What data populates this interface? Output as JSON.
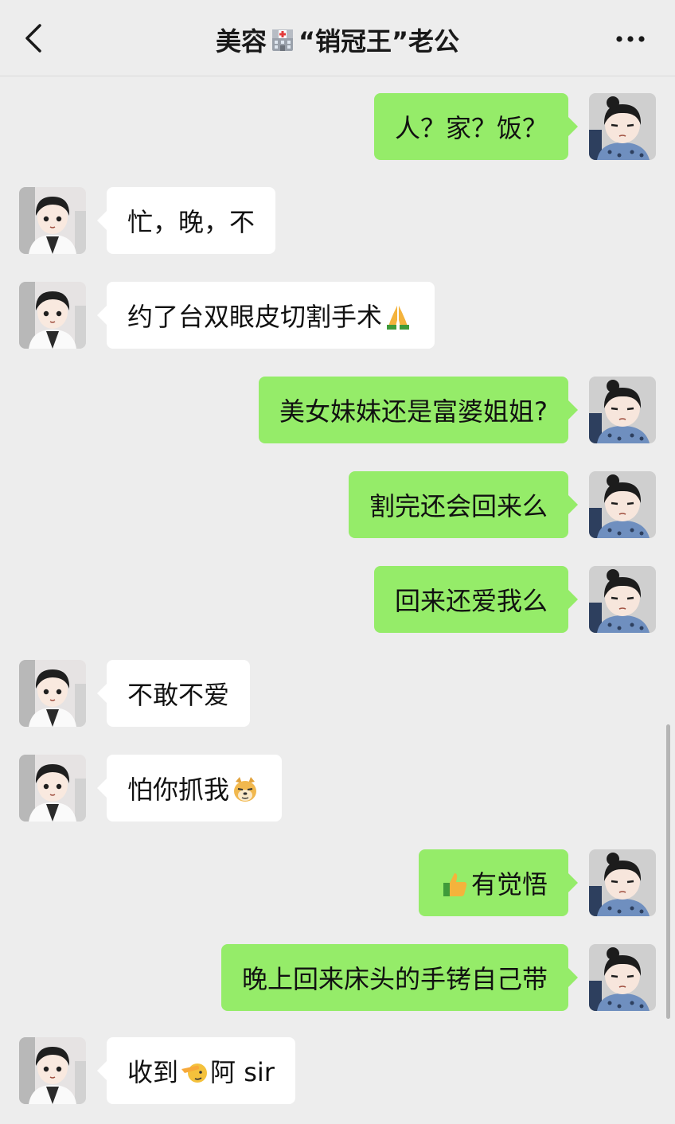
{
  "header": {
    "title_prefix": "美容",
    "title_suffix": "“销冠王”老公",
    "hospital_icon": "hospital-icon",
    "back_icon": "chevron-left-icon",
    "more_icon": "more-dots-icon"
  },
  "colors": {
    "background": "#ededed",
    "sent_bubble": "#95ec69",
    "received_bubble": "#ffffff",
    "text": "#111111"
  },
  "messages": [
    {
      "side": "right",
      "sender": "me",
      "text": "人？家？饭？"
    },
    {
      "side": "left",
      "sender": "husband",
      "text": "忙，晚，不"
    },
    {
      "side": "left",
      "sender": "husband",
      "text": "约了台双眼皮切割手术",
      "emoji_after": "folded-hands-emoji"
    },
    {
      "side": "right",
      "sender": "me",
      "text": "美女妹妹还是富婆姐姐?"
    },
    {
      "side": "right",
      "sender": "me",
      "text": "割完还会回来么"
    },
    {
      "side": "right",
      "sender": "me",
      "text": "回来还爱我么"
    },
    {
      "side": "left",
      "sender": "husband",
      "text": "不敢不爱"
    },
    {
      "side": "left",
      "sender": "husband",
      "text": "怕你抓我",
      "emoji_after": "doge-emoji"
    },
    {
      "side": "right",
      "sender": "me",
      "text": "有觉悟",
      "emoji_before": "thumbs-up-emoji"
    },
    {
      "side": "right",
      "sender": "me",
      "text": "晚上回来床头的手铐自己带"
    },
    {
      "side": "left",
      "sender": "husband",
      "text_before": "收到",
      "emoji_mid": "salute-emoji",
      "text": "阿 sir"
    }
  ]
}
